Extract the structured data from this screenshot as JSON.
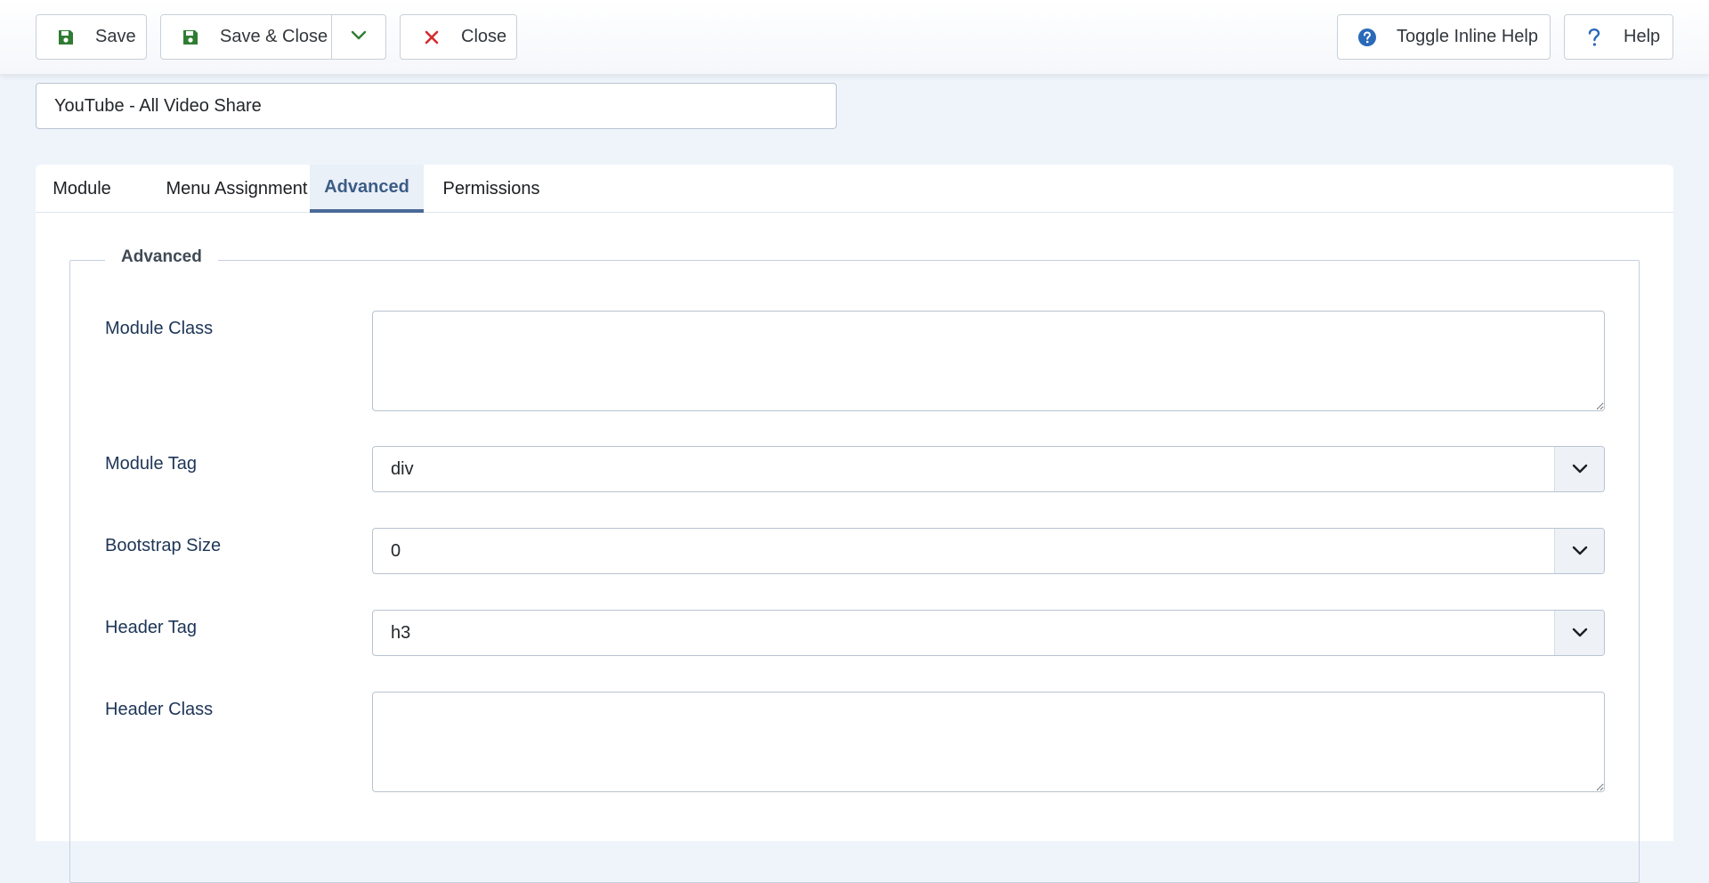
{
  "toolbar": {
    "save_label": "Save",
    "save_close_label": "Save & Close",
    "close_label": "Close",
    "toggle_help_label": "Toggle Inline Help",
    "help_label": "Help"
  },
  "title_field": {
    "value": "YouTube - All Video Share"
  },
  "tabs": [
    {
      "label": "Module"
    },
    {
      "label": "Menu Assignment"
    },
    {
      "label": "Advanced"
    },
    {
      "label": "Permissions"
    }
  ],
  "active_tab": "Advanced",
  "fieldset": {
    "legend": "Advanced",
    "fields": {
      "module_class": {
        "label": "Module Class",
        "value": ""
      },
      "module_tag": {
        "label": "Module Tag",
        "value": "div"
      },
      "bootstrap_size": {
        "label": "Bootstrap Size",
        "value": "0"
      },
      "header_tag": {
        "label": "Header Tag",
        "value": "h3"
      },
      "header_class": {
        "label": "Header Class",
        "value": ""
      }
    }
  },
  "colors": {
    "save_icon": "#2f7d32",
    "close_icon": "#d42a2a",
    "help_icon": "#2a69b8",
    "active_tab": "#3b5c86",
    "label_text": "#1d3557",
    "page_background": "#eff4fb"
  },
  "icons": {
    "save": "floppy-disk-icon",
    "dropdown": "chevron-down-icon",
    "close": "close-icon",
    "toggle_help": "question-circle-icon",
    "help": "question-icon"
  }
}
